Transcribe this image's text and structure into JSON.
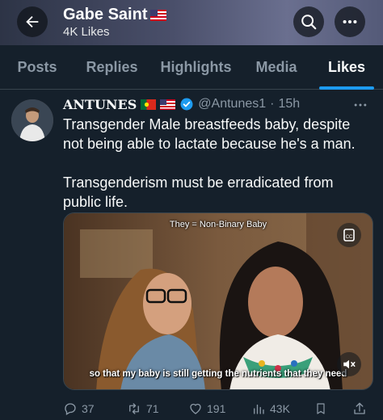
{
  "header": {
    "name": "Gabe Saint",
    "likes_count": "4K Likes",
    "flag_icon": "us-flag-icon"
  },
  "tabs": [
    {
      "label": "Posts",
      "active": false
    },
    {
      "label": "Replies",
      "active": false
    },
    {
      "label": "Highlights",
      "active": false
    },
    {
      "label": "Media",
      "active": false
    },
    {
      "label": "Likes",
      "active": true
    }
  ],
  "tweet": {
    "author_name": "ANTUNES",
    "handle": "@Antunes1",
    "separator": "·",
    "time": "15h",
    "text_line1": "Transgender Male breastfeeds baby, despite not being able to lactate because he's a man.",
    "text_line2": "Transgenderism must be erradicated from public life.",
    "video": {
      "top_caption": "They = Non-Binary Baby",
      "bottom_caption": "so that my baby is still getting the nutrients that they need"
    },
    "stats": {
      "replies": "37",
      "reposts": "71",
      "likes": "191",
      "views": "43K"
    }
  },
  "colors": {
    "background": "#15202b",
    "accent": "#1d9bf0",
    "muted": "#8b98a5",
    "text": "#f7f9f9"
  }
}
